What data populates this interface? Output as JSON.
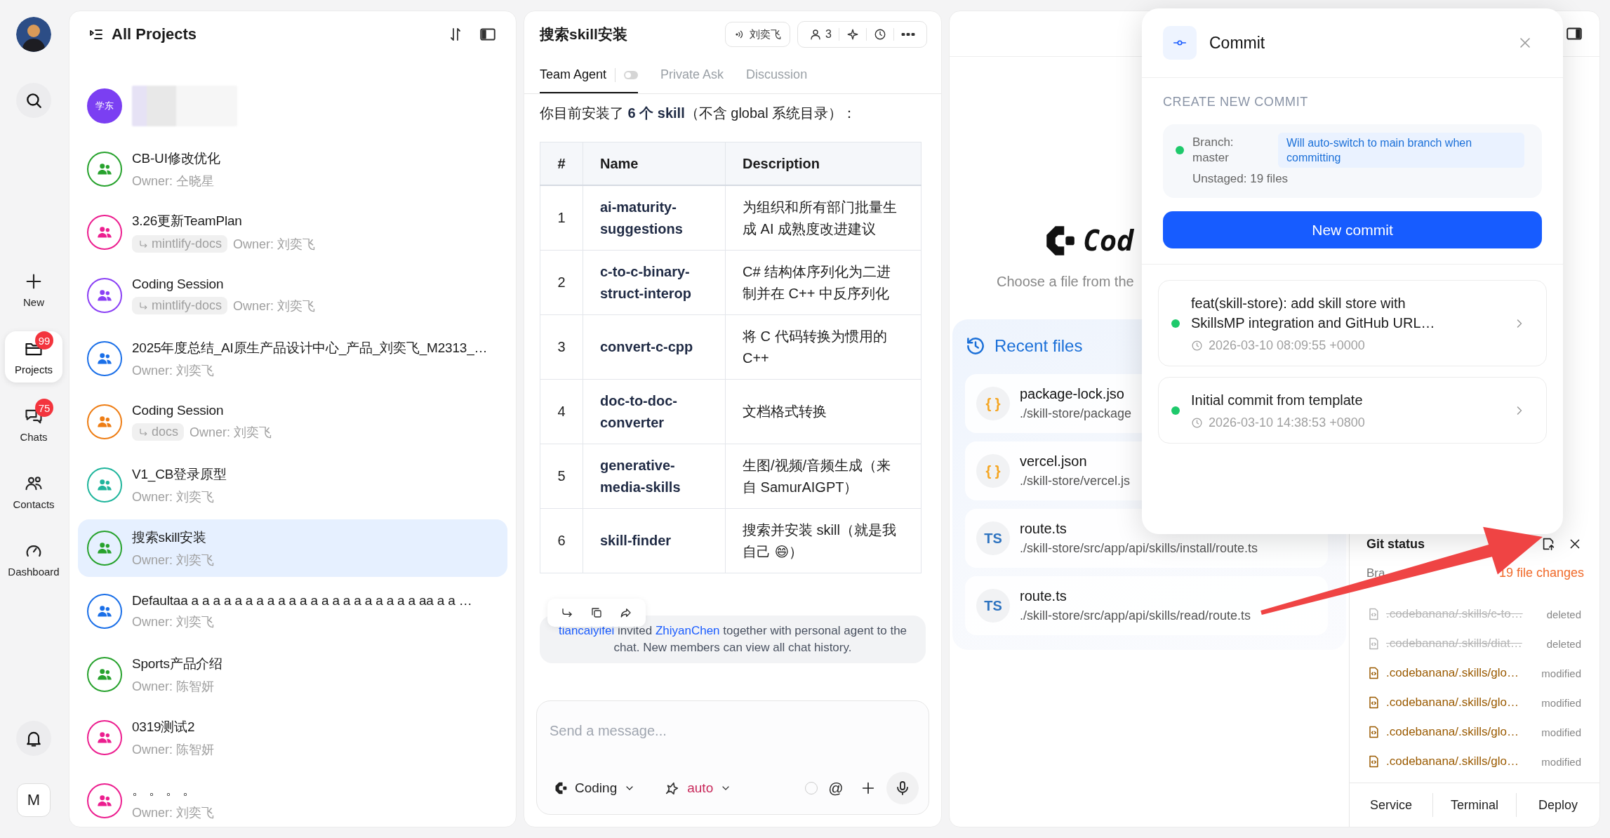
{
  "rail": {
    "nav": [
      {
        "kind": "new",
        "label": "New",
        "selected": false
      },
      {
        "kind": "projects",
        "label": "Projects",
        "selected": true,
        "badge": "99"
      },
      {
        "kind": "chats",
        "label": "Chats",
        "selected": false,
        "badge": "75"
      },
      {
        "kind": "contacts",
        "label": "Contacts",
        "selected": false
      },
      {
        "kind": "dashboard",
        "label": "Dashboard",
        "selected": false
      }
    ],
    "account_initial": "M"
  },
  "projects": {
    "title": "All Projects",
    "items": [
      {
        "kind": "redacted",
        "avatar_text": "学东",
        "color": "#7b3ff2",
        "selected": false
      },
      {
        "kind": "group",
        "title": "CB-UI修改优化",
        "owner": "Owner: 仝晓星",
        "color": "#27a22d",
        "selected": false
      },
      {
        "kind": "group",
        "title": "3.26更新TeamPlan",
        "tag": "mintlify-docs",
        "owner": "Owner: 刘奕飞",
        "color": "#ec1e8f",
        "selected": false
      },
      {
        "kind": "group",
        "title": "Coding Session",
        "tag": "mintlify-docs",
        "owner": "Owner: 刘奕飞",
        "color": "#8a3ff5",
        "selected": false
      },
      {
        "kind": "group",
        "title": "2025年度总结_AI原生产品设计中心_产品_刘奕飞_M2313_…",
        "owner": "Owner: 刘奕飞",
        "color": "#1a6fe8",
        "selected": false
      },
      {
        "kind": "group",
        "title": "Coding Session",
        "tag": "docs",
        "owner": "Owner: 刘奕飞",
        "color": "#ee7d14",
        "selected": false
      },
      {
        "kind": "group",
        "title": "V1_CB登录原型",
        "owner": "Owner: 刘奕飞",
        "color": "#1fb59c",
        "selected": false
      },
      {
        "kind": "group",
        "title": "搜索skill安装",
        "owner": "Owner: 刘奕飞",
        "color": "#27a22d",
        "selected": true
      },
      {
        "kind": "group",
        "title": "Defaultaa a a a a a a a a a a a a a a a a a a a a a aa a a …",
        "owner": "Owner: 刘奕飞",
        "color": "#1a6fe8",
        "selected": false
      },
      {
        "kind": "group",
        "title": "Sports产品介绍",
        "owner": "Owner: 陈智妍",
        "color": "#27a22d",
        "selected": false
      },
      {
        "kind": "group",
        "title": "0319测试2",
        "owner": "Owner: 陈智妍",
        "color": "#ec1e8f",
        "selected": false
      },
      {
        "kind": "group",
        "title": "。 。 。 。",
        "owner": "Owner: 刘奕飞",
        "color": "#ec1e8f",
        "selected": false
      }
    ]
  },
  "chat": {
    "title": "搜索skill安装",
    "speaker": "刘奕飞",
    "member_count": "3",
    "tabs": [
      {
        "label": "Team Agent",
        "selected": true
      },
      {
        "label": "Private Ask",
        "selected": false
      },
      {
        "label": "Discussion",
        "selected": false
      }
    ],
    "agent_toggle_on": false,
    "message": "你目前安装了 **6 个 skill**（不含 global 系统目录）：",
    "table": {
      "columns": [
        "#",
        "Name",
        "Description"
      ],
      "rows": [
        [
          "1",
          "ai-maturity-suggestions",
          "为组织和所有部门批量生成 AI 成熟度改进建议"
        ],
        [
          "2",
          "c-to-c-binary-struct-interop",
          "C# 结构体序列化为二进制并在 C++ 中反序列化"
        ],
        [
          "3",
          "convert-c-cpp",
          "将 C 代码转换为惯用的 C++"
        ],
        [
          "4",
          "doc-to-doc-converter",
          "文档格式转换"
        ],
        [
          "5",
          "generative-media-skills",
          "生图/视频/音频生成（来自 SamurAIGPT）"
        ],
        [
          "6",
          "skill-finder",
          "搜索并安装 skill（就是我自己 😄）"
        ]
      ]
    },
    "notice": [
      {
        "kind": "link",
        "text": "tiancaiyifei"
      },
      {
        "kind": "text",
        "text": " invited "
      },
      {
        "kind": "link",
        "text": "ZhiyanChen"
      },
      {
        "kind": "text",
        "text": " together with personal agent to the chat. New members can view all chat history."
      }
    ],
    "placeholder": "Send a message...",
    "mode": "Coding",
    "model": "auto",
    "mention": "@"
  },
  "editor": {
    "logo_text": "Cod",
    "hint": "Choose a file from the",
    "recent_title": "Recent files",
    "recent": [
      {
        "kind": "json",
        "icon_text": "{ }",
        "name": "package-lock.jso",
        "path": "./skill-store/package"
      },
      {
        "kind": "json",
        "icon_text": "{ }",
        "name": "vercel.json",
        "path": "./skill-store/vercel.js"
      },
      {
        "kind": "ts",
        "icon_text": "TS",
        "name": "route.ts",
        "path": "./skill-store/src/app/api/skills/install/route.ts"
      },
      {
        "kind": "ts",
        "icon_text": "TS",
        "name": "route.ts",
        "path": "./skill-store/src/app/api/skills/read/route.ts"
      }
    ]
  },
  "git": {
    "title": "Git status",
    "branch": "Bra",
    "changes": "19 file changes",
    "files": [
      {
        "kind": "deleted",
        "path": ".codebanana/.skills/c-to…",
        "status": "deleted"
      },
      {
        "kind": "deleted",
        "path": ".codebanana/.skills/diat…",
        "status": "deleted"
      },
      {
        "kind": "modified",
        "path": ".codebanana/.skills/glo…",
        "status": "modified"
      },
      {
        "kind": "modified",
        "path": ".codebanana/.skills/glo…",
        "status": "modified"
      },
      {
        "kind": "modified",
        "path": ".codebanana/.skills/glo…",
        "status": "modified"
      },
      {
        "kind": "modified",
        "path": ".codebanana/.skills/glo…",
        "status": "modified"
      }
    ],
    "tabs": [
      "Service",
      "Terminal",
      "Deploy"
    ]
  },
  "commit": {
    "title": "Commit",
    "section": "CREATE NEW COMMIT",
    "branch": "Branch: master",
    "notice": "Will auto-switch to main branch when committing",
    "unstaged": "Unstaged: 19 files",
    "button": "New commit",
    "history": [
      {
        "message": "feat(skill-store): add skill store with SkillsMP integration and GitHub URL…",
        "time": "2026-03-10 08:09:55 +0000"
      },
      {
        "message": "Initial commit from template",
        "time": "2026-03-10 14:38:53 +0800"
      }
    ]
  }
}
